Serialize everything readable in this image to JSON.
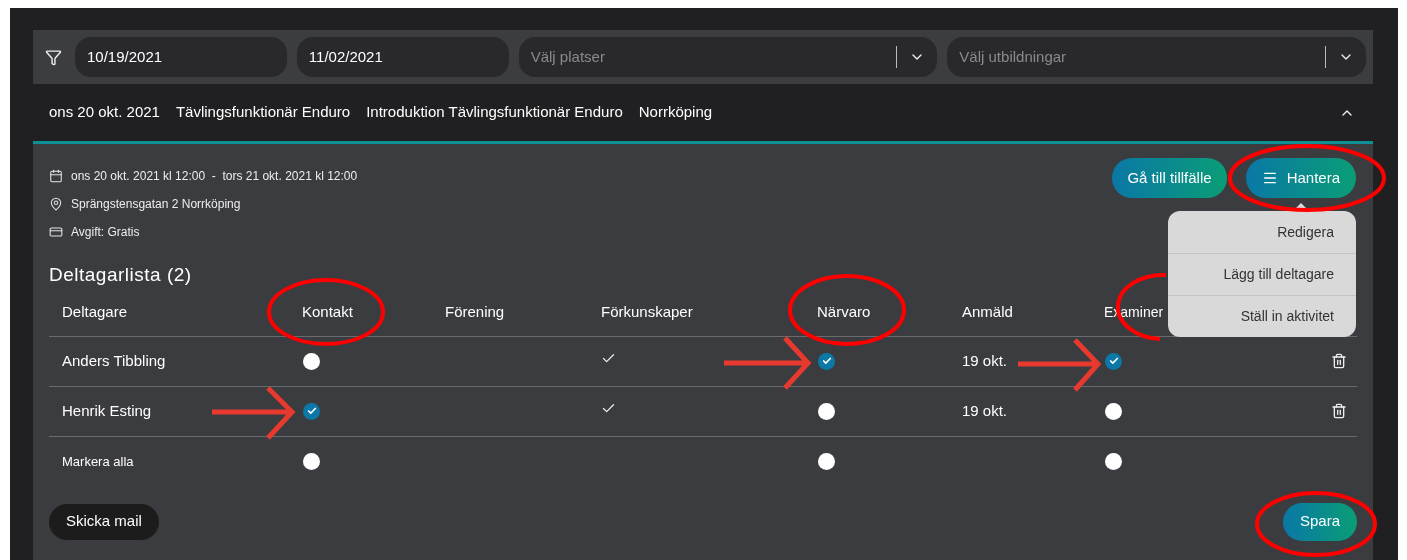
{
  "filters": {
    "date_from": "10/19/2021",
    "date_to": "11/02/2021",
    "places_placeholder": "Välj platser",
    "educations_placeholder": "Välj utbildningar"
  },
  "session": {
    "expanded": true,
    "summary": [
      "ons 20 okt. 2021",
      "Tävlingsfunktionär Enduro",
      "Introduktion Tävlingsfunktionär Enduro",
      "Norrköping"
    ]
  },
  "details": [
    {
      "kind": "date",
      "text": "ons 20 okt. 2021 kl 12:00  -  tors 21 okt. 2021 kl 12:00"
    },
    {
      "kind": "location",
      "text": "Sprängstensgatan 2 Norrköping"
    },
    {
      "kind": "fee",
      "text": "Avgift: Gratis"
    }
  ],
  "actions": [
    "Gå till tillfälle",
    "Hantera"
  ],
  "menu": {
    "open": true,
    "items": [
      "Redigera",
      "Lägg till deltagare",
      "Ställ in aktivitet"
    ]
  },
  "list_title": "Deltagarlista (2)",
  "columns": [
    "Deltagare",
    "Kontakt",
    "Förening",
    "Förkunskaper",
    "Närvaro",
    "Anmäld",
    "Examiner"
  ],
  "rows": [
    {
      "name": "Anders Tibbling",
      "contact": false,
      "prerequisites": true,
      "attendance": true,
      "registered": "19 okt.",
      "examined": true
    },
    {
      "name": "Henrik Esting",
      "contact": true,
      "prerequisites": true,
      "attendance": false,
      "registered": "19 okt.",
      "examined": false
    }
  ],
  "select_all": {
    "label": "Markera alla",
    "contact": false,
    "attendance": false,
    "examined": false
  },
  "buttons": {
    "mail": "Skicka mail",
    "save": "Spara"
  }
}
